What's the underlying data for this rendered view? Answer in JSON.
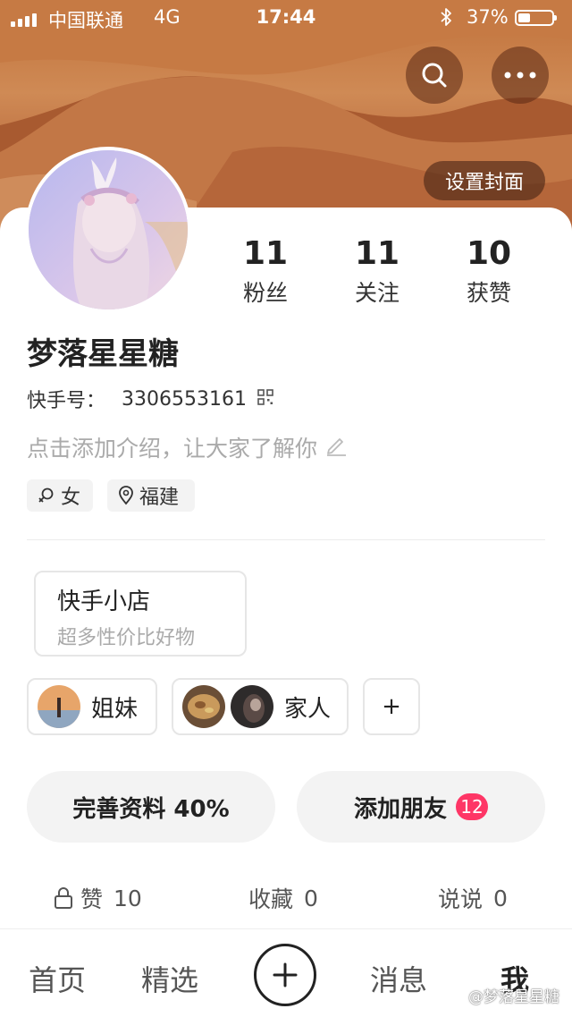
{
  "status_bar": {
    "carrier": "中国联通",
    "network": "4G",
    "time": "17:44",
    "battery_pct": "37%",
    "battery_level": 0.37
  },
  "header": {
    "set_cover_label": "设置封面",
    "search_icon": "search-icon",
    "more_icon": "more-horizontal-icon"
  },
  "profile": {
    "nickname": "梦落星星糖",
    "id_label": "快手号：",
    "id_value": "3306553161",
    "intro_placeholder": "点击添加介绍，让大家了解你",
    "tags": {
      "gender": "女",
      "location": "福建"
    },
    "stats": {
      "fans": {
        "value": "11",
        "label": "粉丝"
      },
      "following": {
        "value": "11",
        "label": "关注"
      },
      "likes": {
        "value": "10",
        "label": "获赞"
      }
    }
  },
  "shop": {
    "title": "快手小店",
    "subtitle": "超多性价比好物"
  },
  "groups": {
    "sisters": "姐妹",
    "family": "家人",
    "add": "+"
  },
  "actions": {
    "complete_profile": "完善资料 40%",
    "add_friends": "添加朋友",
    "add_friends_badge": "12"
  },
  "content_tabs": {
    "likes": {
      "label": "赞",
      "count": "10"
    },
    "favorites": {
      "label": "收藏",
      "count": "0"
    },
    "posts": {
      "label": "说说",
      "count": "0"
    }
  },
  "bottom_nav": {
    "home": "首页",
    "featured": "精选",
    "messages": "消息",
    "me": "我"
  },
  "watermark": "@梦落星星糖",
  "colors": {
    "badge": "#fe3666",
    "cover": "#c0713a"
  }
}
